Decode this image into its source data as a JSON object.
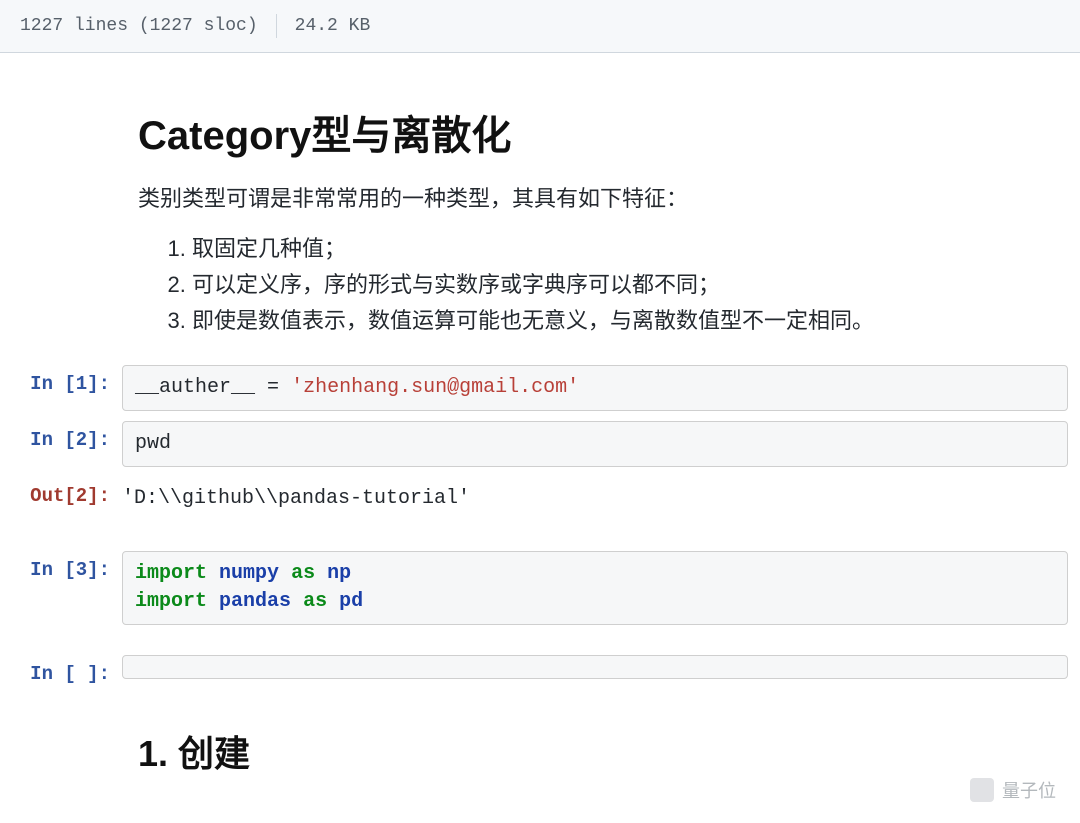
{
  "file_info": {
    "lines": "1227 lines (1227 sloc)",
    "size": "24.2 KB"
  },
  "markdown": {
    "title": "Category型与离散化",
    "intro": "类别类型可谓是非常常用的一种类型，其具有如下特征：",
    "features": [
      "取固定几种值；",
      "可以定义序，序的形式与实数序或字典序可以都不同；",
      "即使是数值表示，数值运算可能也无意义，与离散数值型不一定相同。"
    ],
    "section1": "1. 创建"
  },
  "cells": [
    {
      "prompt": "In [1]:",
      "type": "in",
      "code_tokens": [
        {
          "t": "__auther__ ",
          "c": ""
        },
        {
          "t": "=",
          "c": ""
        },
        {
          "t": " ",
          "c": ""
        },
        {
          "t": "'zhenhang.sun@gmail.com'",
          "c": "tok-str"
        }
      ]
    },
    {
      "prompt": "In [2]:",
      "type": "in",
      "code_tokens": [
        {
          "t": "pwd",
          "c": ""
        }
      ]
    },
    {
      "prompt": "Out[2]:",
      "type": "out",
      "output": "'D:\\\\github\\\\pandas-tutorial'"
    },
    {
      "prompt": "In [3]:",
      "type": "in",
      "code_tokens": [
        {
          "t": "import",
          "c": "tok-kw"
        },
        {
          "t": " ",
          "c": ""
        },
        {
          "t": "numpy",
          "c": "tok-mod"
        },
        {
          "t": " ",
          "c": ""
        },
        {
          "t": "as",
          "c": "tok-kw"
        },
        {
          "t": " ",
          "c": ""
        },
        {
          "t": "np",
          "c": "tok-mod"
        },
        {
          "t": "\n",
          "c": ""
        },
        {
          "t": "import",
          "c": "tok-kw"
        },
        {
          "t": " ",
          "c": ""
        },
        {
          "t": "pandas",
          "c": "tok-mod"
        },
        {
          "t": " ",
          "c": ""
        },
        {
          "t": "as",
          "c": "tok-kw"
        },
        {
          "t": " ",
          "c": ""
        },
        {
          "t": "pd",
          "c": "tok-mod"
        }
      ]
    },
    {
      "prompt": "In [ ]:",
      "type": "in",
      "code_tokens": []
    }
  ],
  "watermark": "量子位"
}
